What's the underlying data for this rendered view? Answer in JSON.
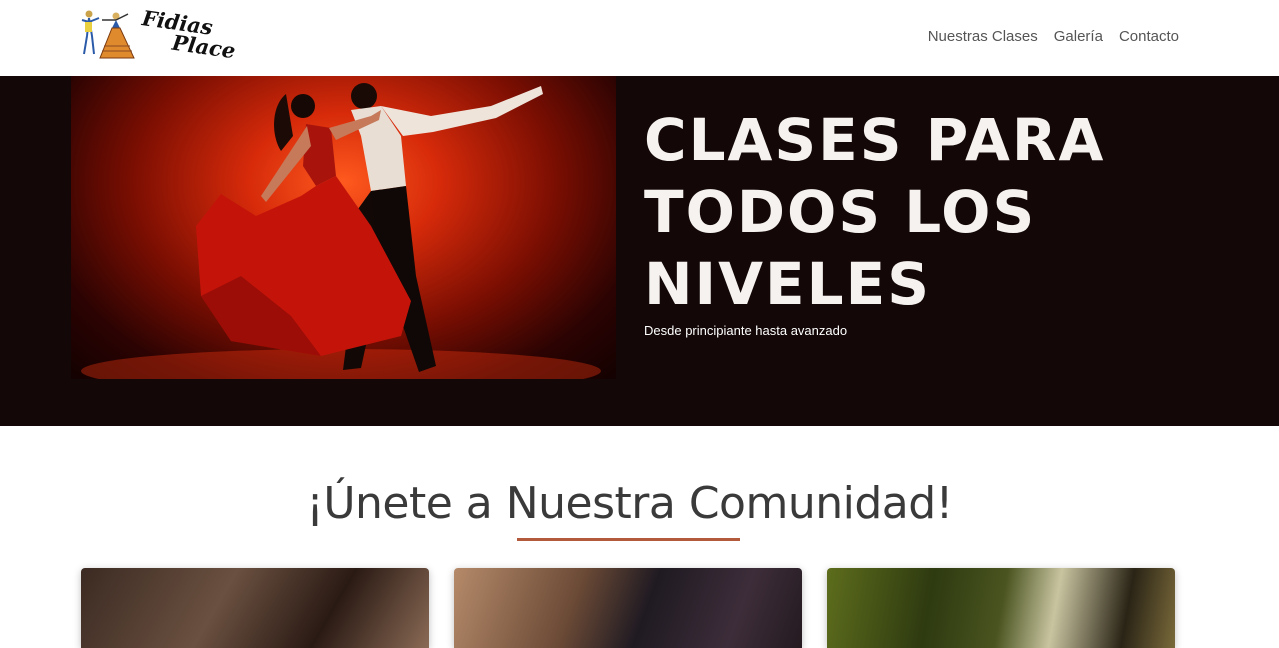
{
  "brand": {
    "line1": "Fidias",
    "line2": "Place"
  },
  "nav": {
    "items": [
      {
        "label": "Nuestras Clases"
      },
      {
        "label": "Galería"
      },
      {
        "label": "Contacto"
      }
    ]
  },
  "hero": {
    "title": "CLASES PARA TODOS LOS NIVELES",
    "subtitle": "Desde principiante hasta avanzado",
    "image_icon": "dancing-couple-image"
  },
  "community": {
    "title": "¡Únete a Nuestra Comunidad!",
    "accent_color": "#b45a3c",
    "cards": [
      {
        "image_icon": "community-photo-1"
      },
      {
        "image_icon": "community-photo-2"
      },
      {
        "image_icon": "community-photo-3"
      }
    ]
  },
  "colors": {
    "hero_bg": "#130707",
    "hero_text": "#f5f2ef",
    "nav_text": "#555555"
  }
}
